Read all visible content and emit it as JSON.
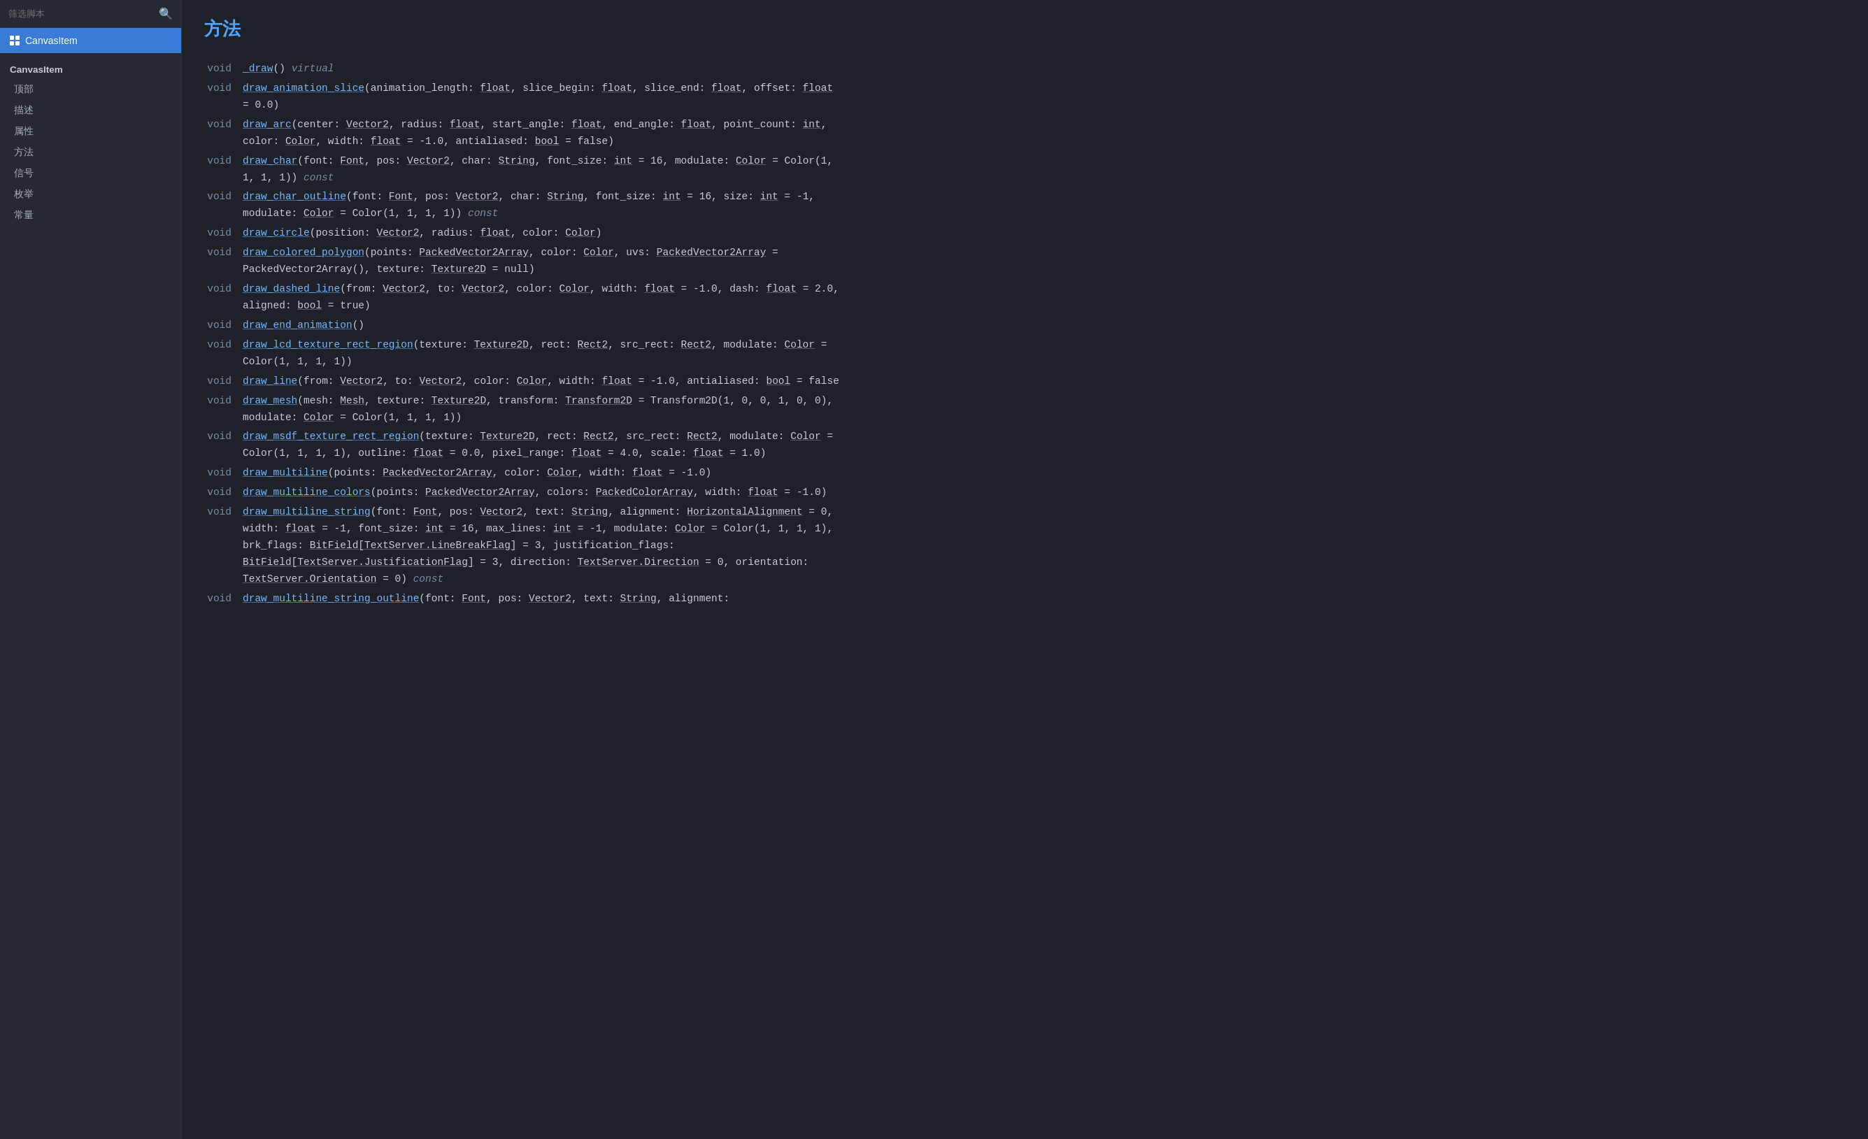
{
  "sidebar": {
    "search_placeholder": "筛选脚本",
    "selected_item": "CanvasItem",
    "section_label": "CanvasItem",
    "nav_items": [
      "顶部",
      "描述",
      "属性",
      "方法",
      "信号",
      "枚举",
      "常量"
    ]
  },
  "main": {
    "page_title": "方法",
    "methods": [
      {
        "ret": "void",
        "name": "_draw",
        "params": "()",
        "suffix": " virtual"
      },
      {
        "ret": "void",
        "name": "draw_animation_slice",
        "params": "(animation_length: float, slice_begin: float, slice_end: float, offset: float = 0.0)"
      },
      {
        "ret": "void",
        "name": "draw_arc",
        "params": "(center: Vector2, radius: float, start_angle: float, end_angle: float, point_count: int, color: Color, width: float = -1.0, antialiased: bool = false)"
      },
      {
        "ret": "void",
        "name": "draw_char",
        "params": "(font: Font, pos: Vector2, char: String, font_size: int = 16, modulate: Color = Color(1, 1, 1, 1))",
        "suffix": " const"
      },
      {
        "ret": "void",
        "name": "draw_char_outline",
        "params": "(font: Font, pos: Vector2, char: String, font_size: int = 16, size: int = -1, modulate: Color = Color(1, 1, 1, 1))",
        "suffix": " const"
      },
      {
        "ret": "void",
        "name": "draw_circle",
        "params": "(position: Vector2, radius: float, color: Color)"
      },
      {
        "ret": "void",
        "name": "draw_colored_polygon",
        "params": "(points: PackedVector2Array, color: Color, uvs: PackedVector2Array = PackedVector2Array(), texture: Texture2D = null)"
      },
      {
        "ret": "void",
        "name": "draw_dashed_line",
        "params": "(from: Vector2, to: Vector2, color: Color, width: float = -1.0, dash: float = 2.0, aligned: bool = true)"
      },
      {
        "ret": "void",
        "name": "draw_end_animation",
        "params": "()"
      },
      {
        "ret": "void",
        "name": "draw_lcd_texture_rect_region",
        "params": "(texture: Texture2D, rect: Rect2, src_rect: Rect2, modulate: Color = Color(1, 1, 1, 1))"
      },
      {
        "ret": "void",
        "name": "draw_line",
        "params": "(from: Vector2, to: Vector2, color: Color, width: float = -1.0, antialiased: bool = false"
      },
      {
        "ret": "void",
        "name": "draw_mesh",
        "params": "(mesh: Mesh, texture: Texture2D, transform: Transform2D = Transform2D(1, 0, 0, 1, 0, 0), modulate: Color = Color(1, 1, 1, 1))"
      },
      {
        "ret": "void",
        "name": "draw_msdf_texture_rect_region",
        "params": "(texture: Texture2D, rect: Rect2, src_rect: Rect2, modulate: Color = Color(1, 1, 1, 1), outline: float = 0.0, pixel_range: float = 4.0, scale: float = 1.0)"
      },
      {
        "ret": "void",
        "name": "draw_multiline",
        "params": "(points: PackedVector2Array, color: Color, width: float = -1.0)"
      },
      {
        "ret": "void",
        "name": "draw_multiline_colors",
        "params": "(points: PackedVector2Array, colors: PackedColorArray, width: float = -1.0)"
      },
      {
        "ret": "void",
        "name": "draw_multiline_string",
        "params": "(font: Font, pos: Vector2, text: String, alignment: HorizontalAlignment = 0, width: float = -1, font_size: int = 16, max_lines: int = -1, modulate: Color = Color(1, 1, 1, 1), brk_flags: BitField[TextServer.LineBreakFlag] = 3, justification_flags: BitField[TextServer.JustificationFlag] = 3, direction: TextServer.Direction = 0, orientation: TextServer.Orientation = 0)",
        "suffix": " const"
      },
      {
        "ret": "void",
        "name": "draw_multiline_string_outline",
        "params": "(font: Font, pos: Vector2, text: String, alignment:"
      }
    ]
  }
}
